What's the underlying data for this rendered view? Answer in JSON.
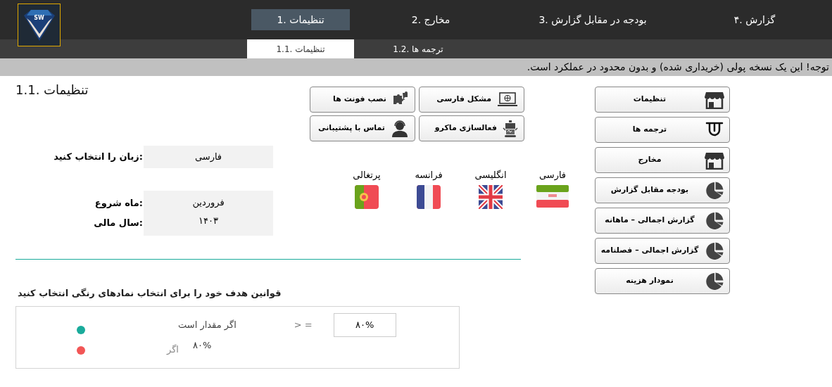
{
  "logo": {
    "text": "SW"
  },
  "top_tabs": [
    {
      "label": "گزارش .۴",
      "selected": false
    },
    {
      "label": "بودجه در مقابل گزارش .3",
      "selected": false
    },
    {
      "label": "مخارج .2",
      "selected": false
    },
    {
      "label": "تنظیمات .1",
      "selected": true
    }
  ],
  "sub_tabs": [
    {
      "label": "ترجمه ها .1.2",
      "selected": false
    },
    {
      "label": "تنظیمات .1.1",
      "selected": true
    }
  ],
  "notice": "توجه! این یک نسخه پولی (خریداری شده) و بدون محدود در عملکرد است.",
  "page_title": "تنظیمات .1.1",
  "tool_buttons": [
    {
      "label": "مشکل فارسی",
      "kind": "laptop"
    },
    {
      "label": "نصب فونت ها",
      "kind": "puzzle"
    },
    {
      "label": "فعالسازی ماکرو",
      "kind": "robot"
    },
    {
      "label": "تماس با پشتیبانی",
      "kind": "headset"
    }
  ],
  "language_field": {
    "label": ":زبان را انتخاب کنید",
    "value": "فارسی"
  },
  "date_fields": [
    {
      "label": ":ماه شروع",
      "value": "فروردین"
    },
    {
      "label": ":سال مالی",
      "value": "۱۴۰۳"
    }
  ],
  "languages": [
    {
      "label": "فارسی",
      "kind": "iran"
    },
    {
      "label": "انگلیسی",
      "kind": "britain"
    },
    {
      "label": "فرانسه",
      "kind": "france"
    },
    {
      "label": "پرتغالی",
      "kind": "portugal"
    }
  ],
  "nav_buttons": [
    {
      "label": "تنظیمات",
      "kind": "store"
    },
    {
      "label": "ترجمه ها",
      "kind": "tongue"
    },
    {
      "label": "مخارج",
      "kind": "store"
    },
    {
      "label": "بودجه مقابل گزارش",
      "kind": "pie"
    },
    {
      "label": "گزارش اجمالی – ماهانه",
      "kind": "pie"
    },
    {
      "label": "گزارش اجمالی – فصلنامه",
      "kind": "pie"
    },
    {
      "label": "نمودار هزینه",
      "kind": "pie"
    }
  ],
  "rules": {
    "title": "قوانین هدف خود را برای انتخاب نمادهای رنگی انتخاب کنید",
    "rows": [
      {
        "kind": "input",
        "color": "#1aab9b",
        "label": "اگر مقدار است",
        "operator": "> =",
        "value": "۸۰%"
      },
      {
        "kind": "text",
        "color": "#f25656",
        "label": "اگر",
        "value": "۸۰%"
      }
    ]
  }
}
